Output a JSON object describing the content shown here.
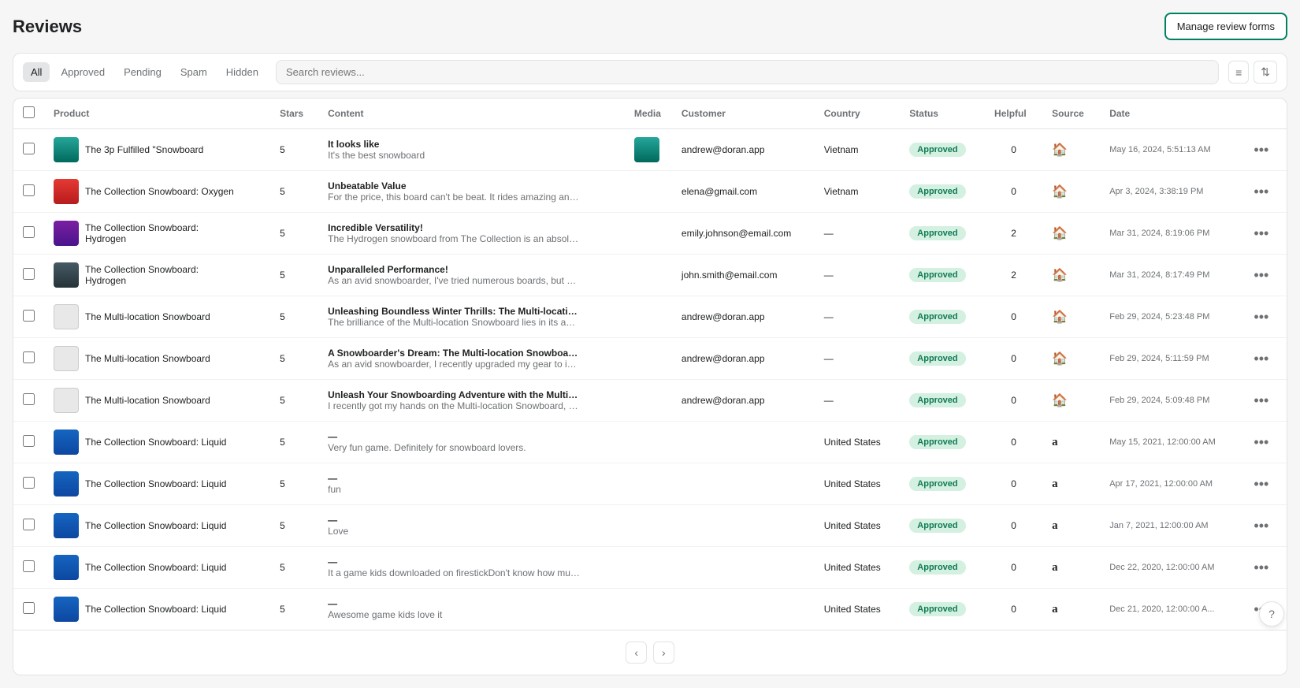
{
  "page": {
    "title": "Reviews",
    "manage_btn": "Manage review forms"
  },
  "filters": {
    "tabs": [
      {
        "id": "all",
        "label": "All",
        "active": true
      },
      {
        "id": "approved",
        "label": "Approved",
        "active": false
      },
      {
        "id": "pending",
        "label": "Pending",
        "active": false
      },
      {
        "id": "spam",
        "label": "Spam",
        "active": false
      },
      {
        "id": "hidden",
        "label": "Hidden",
        "active": false
      }
    ]
  },
  "table": {
    "columns": [
      "Product",
      "Stars",
      "Content",
      "Media",
      "Customer",
      "Country",
      "Status",
      "Helpful",
      "Source",
      "Date"
    ],
    "rows": [
      {
        "id": 1,
        "product": "The 3p Fulfilled &quot;Snowboard",
        "product_display": "The 3p Fulfilled \"Snowboard",
        "thumb_class": "snowboard-1",
        "stars": 5,
        "title": "It looks like",
        "body": "It's the best snowboard",
        "has_media": true,
        "customer": "andrew@doran.app",
        "country": "Vietnam",
        "status": "Approved",
        "helpful": 0,
        "source": "shop",
        "date": "May 16, 2024, 5:51:13 AM"
      },
      {
        "id": 2,
        "product": "The Collection Snowboard: Oxygen",
        "product_display": "The Collection Snowboard: Oxygen",
        "thumb_class": "snowboard-2",
        "stars": 5,
        "title": "Unbeatable Value",
        "body": "For the price, this board can't be beat. It rides amazing and feels like a ...",
        "has_media": false,
        "customer": "elena@gmail.com",
        "country": "Vietnam",
        "status": "Approved",
        "helpful": 0,
        "source": "shop",
        "date": "Apr 3, 2024, 3:38:19 PM"
      },
      {
        "id": 3,
        "product": "The Collection Snowboard: Hydrogen",
        "product_display": "The Collection Snowboard: Hydrogen",
        "thumb_class": "snowboard-3",
        "stars": 5,
        "title": "Incredible Versatility!",
        "body": "The Hydrogen snowboard from The Collection is an absolute game-ch...",
        "has_media": false,
        "customer": "emily.johnson@email.com",
        "country": "—",
        "status": "Approved",
        "helpful": 2,
        "source": "shop",
        "date": "Mar 31, 2024, 8:19:06 PM"
      },
      {
        "id": 4,
        "product": "The Collection Snowboard: Hydrogen",
        "product_display": "The Collection Snowboard: Hydrogen",
        "thumb_class": "snowboard-4",
        "stars": 5,
        "title": "Unparalleled Performance!",
        "body": "As an avid snowboarder, I've tried numerous boards, but none compar...",
        "has_media": false,
        "customer": "john.smith@email.com",
        "country": "—",
        "status": "Approved",
        "helpful": 2,
        "source": "shop",
        "date": "Mar 31, 2024, 8:17:49 PM"
      },
      {
        "id": 5,
        "product": "The Multi-location Snowboard",
        "product_display": "The Multi-location Snowboard",
        "thumb_class": "snowboard-placeholder",
        "stars": 5,
        "title": "Unleashing Boundless Winter Thrills: The Multi-location Snowbo:",
        "body": "The brilliance of the Multi-location Snowboard lies in its adaptability. It...",
        "has_media": false,
        "customer": "andrew@doran.app",
        "country": "—",
        "status": "Approved",
        "helpful": 0,
        "source": "shop",
        "date": "Feb 29, 2024, 5:23:48 PM"
      },
      {
        "id": 6,
        "product": "The Multi-location Snowboard",
        "product_display": "The Multi-location Snowboard",
        "thumb_class": "snowboard-placeholder",
        "stars": 5,
        "title": "A Snowboarder's Dream: The Multi-location Snowboard Unleash:",
        "body": "As an avid snowboarder, I recently upgraded my gear to include the M...",
        "has_media": false,
        "customer": "andrew@doran.app",
        "country": "—",
        "status": "Approved",
        "helpful": 0,
        "source": "shop",
        "date": "Feb 29, 2024, 5:11:59 PM"
      },
      {
        "id": 7,
        "product": "The Multi-location Snowboard",
        "product_display": "The Multi-location Snowboard",
        "thumb_class": "snowboard-placeholder",
        "stars": 5,
        "title": "Unleash Your Snowboarding Adventure with the Multi-location S:",
        "body": "I recently got my hands on the Multi-location Snowboard, and I must s...",
        "has_media": false,
        "customer": "andrew@doran.app",
        "country": "—",
        "status": "Approved",
        "helpful": 0,
        "source": "shop",
        "date": "Feb 29, 2024, 5:09:48 PM"
      },
      {
        "id": 8,
        "product": "The Collection Snowboard: Liquid",
        "product_display": "The Collection Snowboard: Liquid",
        "thumb_class": "snowboard-5",
        "stars": 5,
        "title": "—",
        "body": "Very fun game. Definitely for snowboard lovers.",
        "has_media": false,
        "customer": "",
        "country": "United States",
        "status": "Approved",
        "helpful": 0,
        "source": "amazon",
        "date": "May 15, 2021, 12:00:00 AM"
      },
      {
        "id": 9,
        "product": "The Collection Snowboard: Liquid",
        "product_display": "The Collection Snowboard: Liquid",
        "thumb_class": "snowboard-5",
        "stars": 5,
        "title": "—",
        "body": "fun",
        "has_media": false,
        "customer": "",
        "country": "United States",
        "status": "Approved",
        "helpful": 0,
        "source": "amazon",
        "date": "Apr 17, 2021, 12:00:00 AM"
      },
      {
        "id": 10,
        "product": "The Collection Snowboard: Liquid",
        "product_display": "The Collection Snowboard: Liquid",
        "thumb_class": "snowboard-5",
        "stars": 5,
        "title": "—",
        "body": "Love",
        "has_media": false,
        "customer": "",
        "country": "United States",
        "status": "Approved",
        "helpful": 0,
        "source": "amazon",
        "date": "Jan 7, 2021, 12:00:00 AM"
      },
      {
        "id": 11,
        "product": "The Collection Snowboard: Liquid",
        "product_display": "The Collection Snowboard: Liquid",
        "thumb_class": "snowboard-5",
        "stars": 5,
        "title": "—",
        "body": "It a game kids downloaded on firestickDon't know how much more I ca...",
        "has_media": false,
        "customer": "",
        "country": "United States",
        "status": "Approved",
        "helpful": 0,
        "source": "amazon",
        "date": "Dec 22, 2020, 12:00:00 AM"
      },
      {
        "id": 12,
        "product": "The Collection Snowboard: Liquid",
        "product_display": "The Collection Snowboard: Liquid",
        "thumb_class": "snowboard-5",
        "stars": 5,
        "title": "—",
        "body": "Awesome game kids love it",
        "has_media": false,
        "customer": "",
        "country": "United States",
        "status": "Approved",
        "helpful": 0,
        "source": "amazon",
        "date": "Dec 21, 2020, 12:00:00 A..."
      }
    ]
  },
  "pagination": {
    "prev_label": "‹",
    "next_label": "›"
  },
  "icons": {
    "filter": "≡",
    "sort": "⇅",
    "shop": "🏠",
    "amazon": "a",
    "more": "•••",
    "help": "?"
  }
}
